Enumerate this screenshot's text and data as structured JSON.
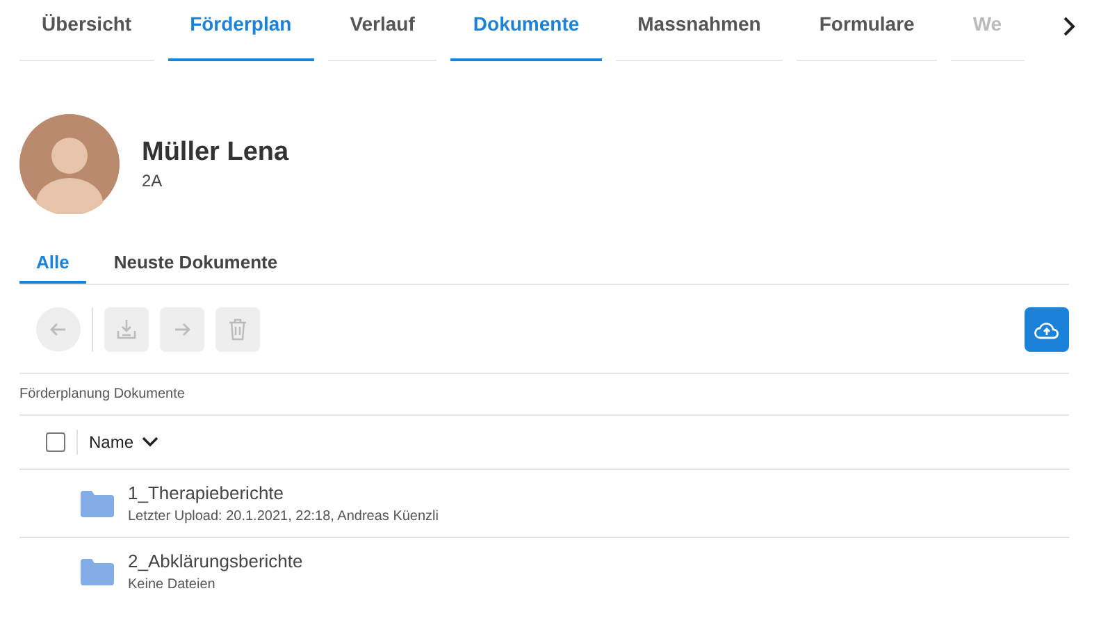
{
  "tabs": [
    {
      "label": "Übersicht",
      "selected": false
    },
    {
      "label": "Förderplan",
      "selected": true
    },
    {
      "label": "Verlauf",
      "selected": false
    },
    {
      "label": "Dokumente",
      "selected": true
    },
    {
      "label": "Massnahmen",
      "selected": false
    },
    {
      "label": "Formulare",
      "selected": false
    },
    {
      "label": "We",
      "selected": false
    }
  ],
  "person": {
    "name": "Müller Lena",
    "class": "2A"
  },
  "subtabs": [
    {
      "label": "Alle",
      "selected": true
    },
    {
      "label": "Neuste Dokumente",
      "selected": false
    }
  ],
  "toolbar": [
    {
      "kind": "back",
      "disabled": true
    },
    {
      "kind": "download",
      "disabled": true
    },
    {
      "kind": "move",
      "disabled": true
    },
    {
      "kind": "delete",
      "disabled": true
    },
    {
      "kind": "upload",
      "disabled": false
    }
  ],
  "breadcrumb": "Förderplanung Dokumente",
  "table": {
    "select_all_checked": false,
    "column": "Name",
    "rows": [
      {
        "name": "1_Therapieberichte",
        "detail": "Letzter Upload: 20.1.2021, 22:18, Andreas Küenzli"
      },
      {
        "name": "2_Abklärungsberichte",
        "detail": "Keine Dateien"
      }
    ]
  }
}
